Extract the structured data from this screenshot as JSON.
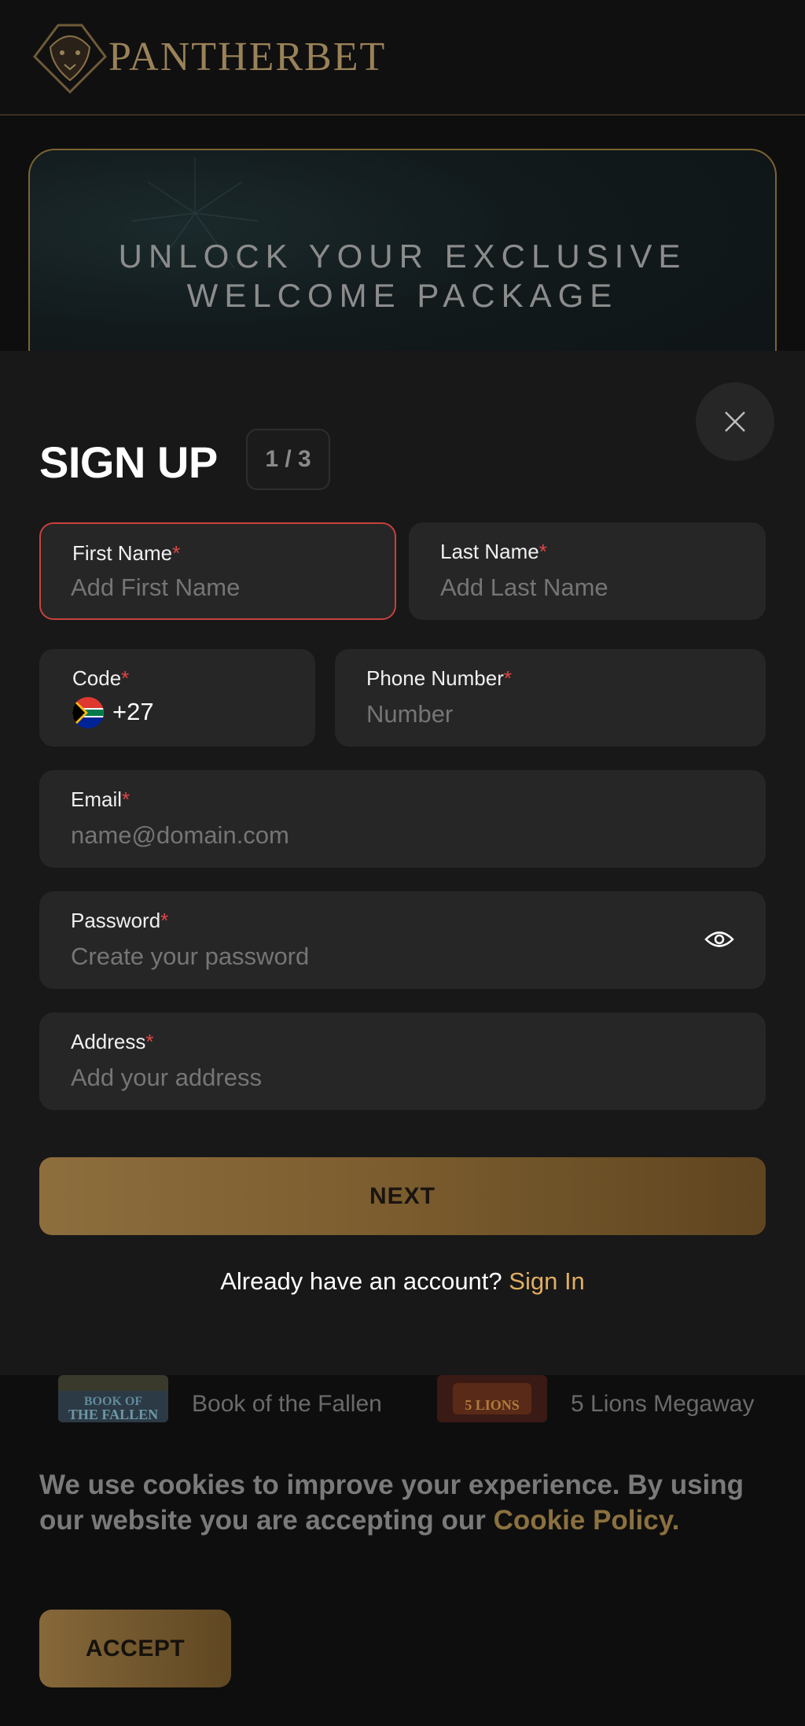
{
  "header": {
    "brand": "PANTHERBET"
  },
  "banner": {
    "line1": "UNLOCK YOUR EXCLUSIVE",
    "line2": "WELCOME PACKAGE"
  },
  "modal": {
    "title": "SIGN UP",
    "step": "1 / 3",
    "close_icon": "close-icon",
    "fields": {
      "first_name": {
        "label": "First Name",
        "placeholder": "Add First Name",
        "required_mark": "*"
      },
      "last_name": {
        "label": "Last Name",
        "placeholder": "Add Last Name",
        "required_mark": "*"
      },
      "code": {
        "label": "Code",
        "value": "+27",
        "required_mark": "*",
        "flag": "south-africa-flag-icon"
      },
      "phone": {
        "label": "Phone Number",
        "placeholder": "Number",
        "required_mark": "*"
      },
      "email": {
        "label": "Email",
        "placeholder": "name@domain.com",
        "required_mark": "*"
      },
      "password": {
        "label": "Password",
        "placeholder": "Create your password",
        "required_mark": "*",
        "toggle_icon": "eye-icon"
      },
      "address": {
        "label": "Address",
        "placeholder": "Add your address",
        "required_mark": "*"
      }
    },
    "next_label": "NEXT",
    "account_prompt": "Already have an account?",
    "signin_label": "Sign In"
  },
  "games": [
    {
      "name": "Book of the Fallen"
    },
    {
      "name": "5 Lions Megaway"
    }
  ],
  "cookie": {
    "text": "We use cookies to improve your experience. By using our website you are accepting our",
    "link": "Cookie Policy.",
    "accept_label": "ACCEPT"
  },
  "colors": {
    "accent_gold": "#e0ae62",
    "error_red": "#c9403f",
    "required_red": "#e04545",
    "modal_bg": "#181818",
    "field_bg": "#262626"
  }
}
